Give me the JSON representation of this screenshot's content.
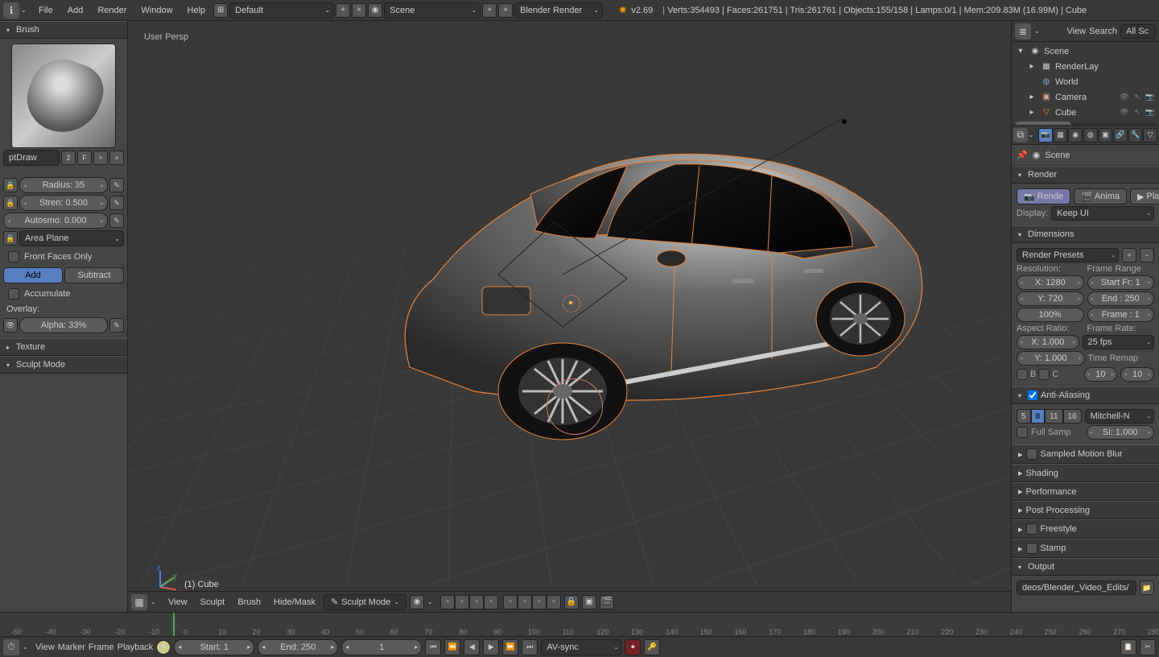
{
  "topbar": {
    "menus": [
      "File",
      "Add",
      "Render",
      "Window",
      "Help"
    ],
    "layout": "Default",
    "scene": "Scene",
    "engine": "Blender Render",
    "version": "v2.69",
    "stats": "Verts:354493 | Faces:261751 | Tris:261761 | Objects:155/158 | Lamps:0/1 | Mem:209.83M (16.99M) | Cube"
  },
  "toolshelf": {
    "brush_header": "Brush",
    "brush_name": "ptDraw",
    "brush_users": "2",
    "fake": "F",
    "radius": "Radius: 35",
    "strength": "Stren: 0.500",
    "autosmooth": "Autosmo: 0.000",
    "plane": "Area Plane",
    "front_faces": "Front Faces Only",
    "add": "Add",
    "subtract": "Subtract",
    "accumulate": "Accumulate",
    "overlay_label": "Overlay:",
    "alpha": "Alpha: 33%",
    "texture_header": "Texture",
    "sculpt_header": "Sculpt Mode"
  },
  "viewport": {
    "persp": "User Persp",
    "obj": "(1) Cube",
    "header": {
      "menus": [
        "View",
        "Sculpt",
        "Brush",
        "Hide/Mask"
      ],
      "mode": "Sculpt Mode"
    }
  },
  "outliner": {
    "view": "View",
    "search": "Search",
    "all_sc": "All Sc",
    "items": [
      {
        "label": "Scene",
        "icon": "◉",
        "indent": 0,
        "expand": "▾"
      },
      {
        "label": "RenderLay",
        "icon": "▦",
        "indent": 1,
        "expand": "▸"
      },
      {
        "label": "World",
        "icon": "◍",
        "indent": 1,
        "expand": ""
      },
      {
        "label": "Camera",
        "icon": "▣",
        "indent": 1,
        "expand": "▸",
        "vis": true
      },
      {
        "label": "Cube",
        "icon": "▽",
        "indent": 1,
        "expand": "▸",
        "vis": true
      }
    ]
  },
  "properties": {
    "breadcrumb": "Scene",
    "render_hdr": "Render",
    "render_btn": "Rende",
    "anim_btn": "Anima",
    "play_btn": "Play",
    "display_lbl": "Display:",
    "display_val": "Keep UI",
    "dims_hdr": "Dimensions",
    "presets": "Render Presets",
    "res_lbl": "Resolution:",
    "res_x": "X: 1280",
    "res_y": "Y: 720",
    "res_pct": "100%",
    "frange_lbl": "Frame Range",
    "start_fr": "Start Fr: 1",
    "end_fr": "End : 250",
    "frame_step": "Frame : 1",
    "aspect_lbl": "Aspect Ratio:",
    "asp_x": "X: 1.000",
    "asp_y": "Y: 1.000",
    "frate_lbl": "Frame Rate:",
    "frate": "25 fps",
    "tremap_lbl": "Time Remap",
    "tremap_o": "10",
    "tremap_n": "10",
    "border_b": "B",
    "border_c": "C",
    "aa_hdr": "Anti-Aliasing",
    "aa5": "5",
    "aa8": "8",
    "aa11": "11",
    "aa16": "16",
    "aa_filter": "Mitchell-N",
    "full_sample": "Full Samp",
    "aa_size": "Si: 1.000",
    "closed_panels": [
      "Sampled Motion Blur",
      "Shading",
      "Performance",
      "Post Processing",
      "Freestyle",
      "Stamp"
    ],
    "output_hdr": "Output",
    "output_path": "deos/Blender_Video_Edits/"
  },
  "timeline": {
    "menus": [
      "View",
      "Marker",
      "Frame",
      "Playback"
    ],
    "start": "Start: 1",
    "end": "End: 250",
    "current": "1",
    "sync": "AV-sync",
    "ticks": [
      -50,
      -40,
      -30,
      -20,
      -10,
      0,
      10,
      20,
      30,
      40,
      50,
      60,
      70,
      80,
      90,
      100,
      110,
      120,
      130,
      140,
      150,
      160,
      170,
      180,
      190,
      200,
      210,
      220,
      230,
      240,
      250,
      260,
      270,
      280
    ]
  }
}
